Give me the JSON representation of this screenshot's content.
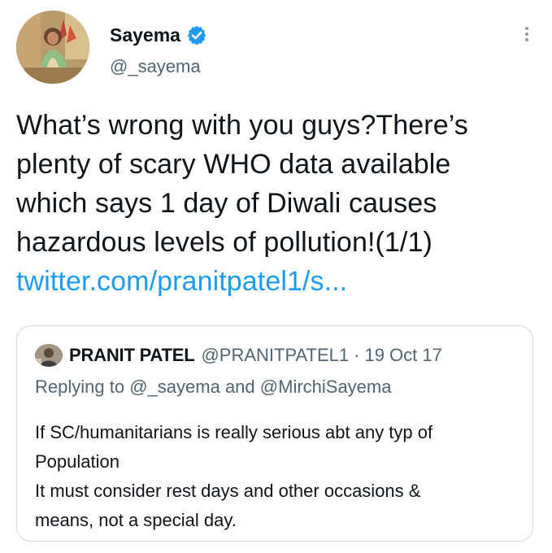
{
  "author": {
    "display_name": "Sayema",
    "handle": "@_sayema",
    "verified": true
  },
  "tweet": {
    "text_lines": [
      "What’s wrong with you guys?There’s",
      "plenty of scary WHO data available",
      "which says 1 day of Diwali causes",
      "hazardous levels of pollution!(1/1)"
    ],
    "link": "twitter.com/pranitpatel1/s..."
  },
  "quoted": {
    "name": "PRANIT PATEL",
    "handle": "@PRANITPATEL1",
    "separator": "·",
    "date": "19 Oct 17",
    "replying_prefix": "Replying to",
    "reply_mention_1": "@_sayema",
    "reply_and": "and",
    "reply_mention_2": "@MirchiSayema",
    "body_lines": [
      "If SC/humanitarians is really serious abt any typ of",
      "Population",
      "It must consider rest days and other occasions &",
      "means, not a special day."
    ]
  },
  "colors": {
    "link": "#1d9bf0",
    "secondary_text": "#536471",
    "border": "#cfd9de",
    "verified_badge": "#1d9bf0"
  },
  "icons": {
    "verified": "verified-badge-icon",
    "more": "more-options-icon"
  }
}
